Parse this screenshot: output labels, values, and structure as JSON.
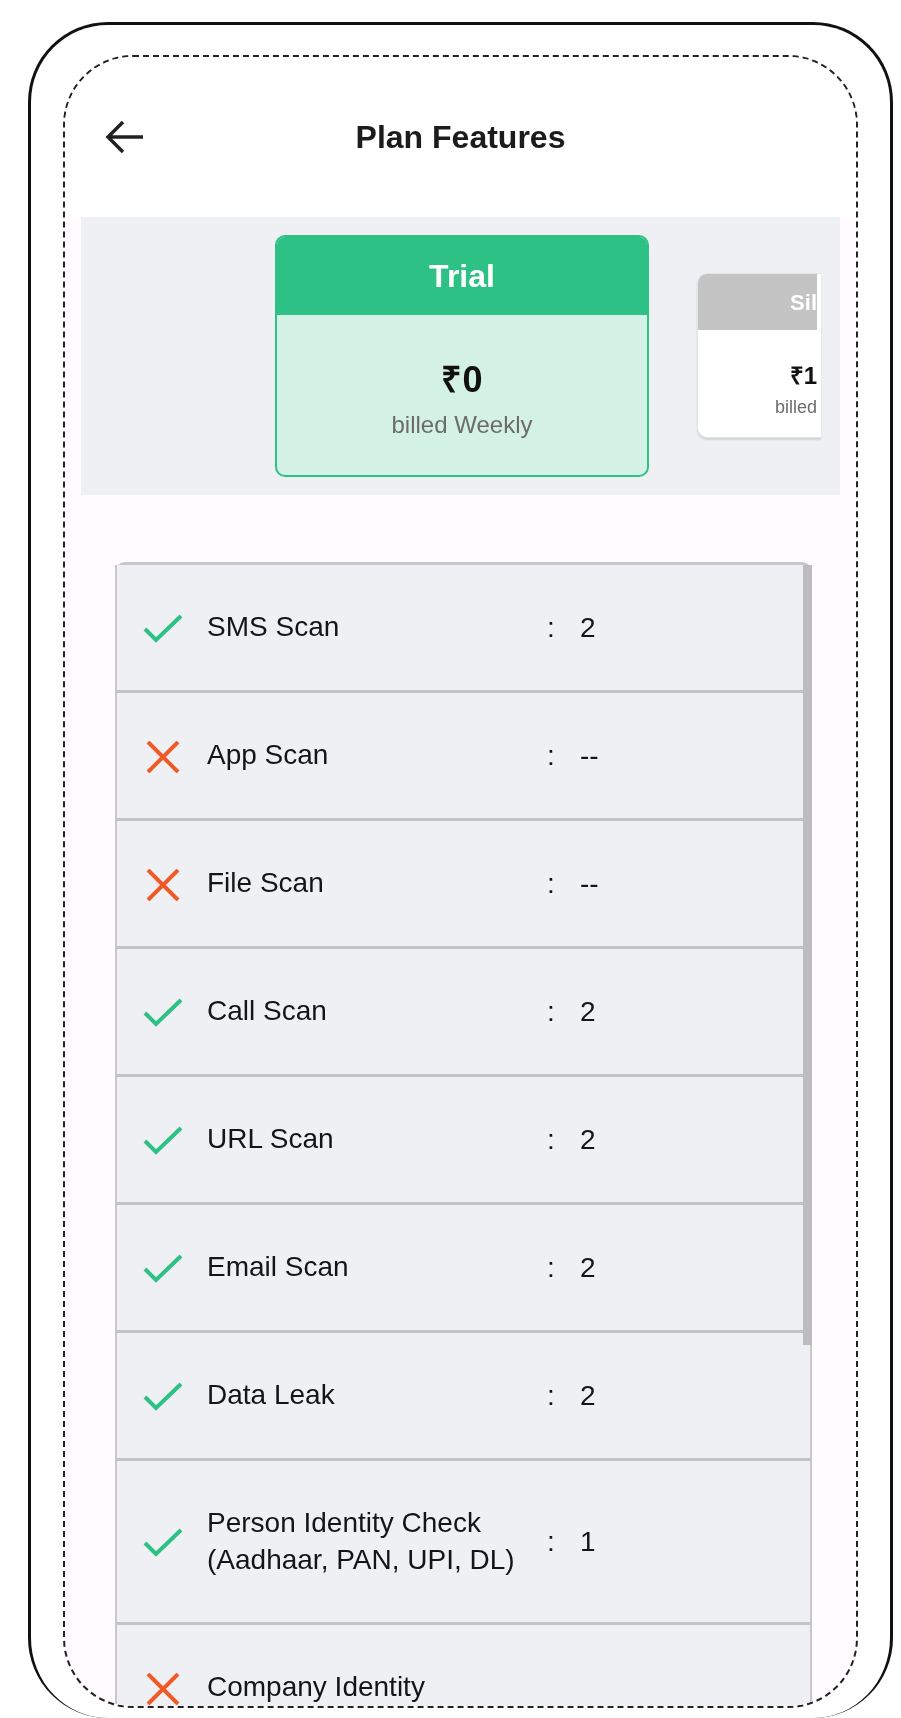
{
  "header": {
    "title": "Plan Features"
  },
  "plans": [
    {
      "name": "Trial",
      "price": "₹0",
      "billing": "billed Weekly",
      "selected": true
    },
    {
      "name": "Sil",
      "price": "₹1",
      "billing": "billed",
      "selected": false
    }
  ],
  "features": [
    {
      "label": "SMS Scan",
      "included": true,
      "separator": ":",
      "value": "2"
    },
    {
      "label": "App Scan",
      "included": false,
      "separator": ":",
      "value": "--"
    },
    {
      "label": "File Scan",
      "included": false,
      "separator": ":",
      "value": "--"
    },
    {
      "label": "Call Scan",
      "included": true,
      "separator": ":",
      "value": "2"
    },
    {
      "label": "URL Scan",
      "included": true,
      "separator": ":",
      "value": "2"
    },
    {
      "label": "Email Scan",
      "included": true,
      "separator": ":",
      "value": "2"
    },
    {
      "label": "Data Leak",
      "included": true,
      "separator": ":",
      "value": "2"
    },
    {
      "label": "Person Identity Check (Aadhaar, PAN, UPI, DL)",
      "included": true,
      "separator": ":",
      "value": "1"
    },
    {
      "label": "Company Identity",
      "included": false
    }
  ]
}
